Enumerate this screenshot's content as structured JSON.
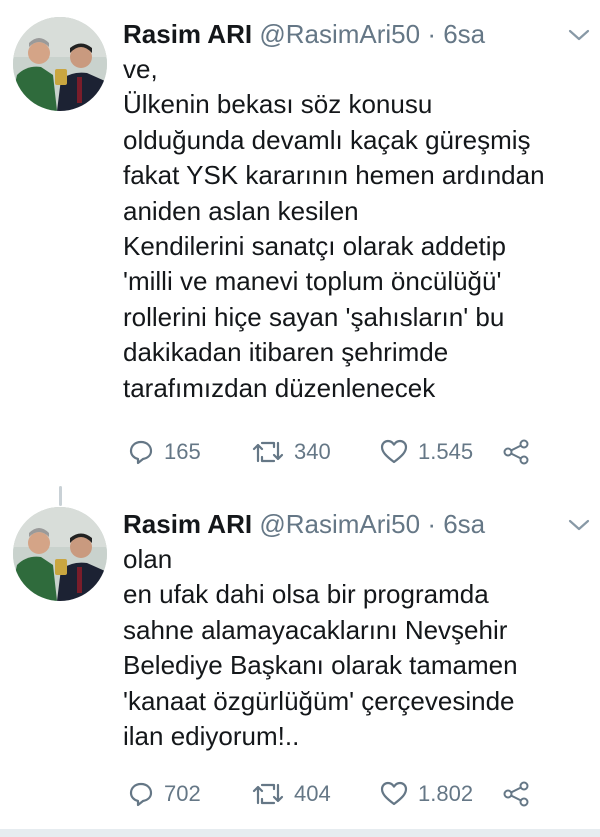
{
  "tweets": [
    {
      "author_name": "Rasim ARI",
      "handle": "@RasimAri50",
      "sep": "·",
      "time": "6sa",
      "text": "ve,\nÜlkenin bekası söz konusu\nolduğunda devamlı kaçak güreşmiş\nfakat YSK kararının hemen ardından\naniden aslan kesilen\nKendilerini sanatçı olarak addetip\n'milli ve manevi toplum öncülüğü'\nrollerini hiçe sayan 'şahısların' bu\ndakikadan itibaren şehrimde\ntarafımızdan düzenlenecek",
      "replies": "165",
      "retweets": "340",
      "likes": "1.545"
    },
    {
      "author_name": "Rasim ARI",
      "handle": "@RasimAri50",
      "sep": "·",
      "time": "6sa",
      "text": "olan\nen ufak dahi olsa bir programda\nsahne alamayacaklarını Nevşehir\nBelediye Başkanı olarak tamamen\n'kanaat özgürlüğüm' çerçevesinde\nilan ediyorum!..",
      "replies": "702",
      "retweets": "404",
      "likes": "1.802"
    }
  ],
  "icons": {
    "reply": "reply-icon",
    "retweet": "retweet-icon",
    "like": "heart-icon",
    "share": "share-icon",
    "menu": "chevron-down-icon"
  },
  "colors": {
    "text": "#14171a",
    "muted": "#657786",
    "background": "#ffffff"
  }
}
